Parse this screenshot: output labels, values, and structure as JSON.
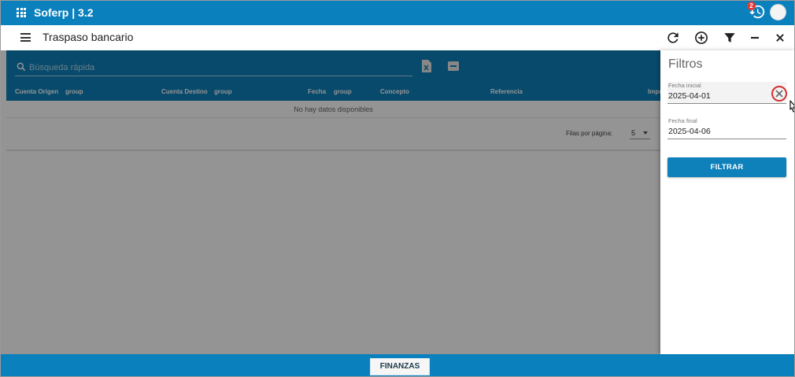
{
  "app": {
    "title": "Soferp | 3.2",
    "notification_count": "2"
  },
  "toolbar": {
    "title": "Traspaso bancario"
  },
  "table": {
    "search_placeholder": "Búsqueda rápida",
    "columns": [
      "Cuenta Origen",
      "group",
      "Cuenta Destino",
      "group",
      "Fecha",
      "group",
      "Concepto",
      "Referencia",
      "Impo"
    ],
    "empty_message": "No hay datos disponibles",
    "rows_per_page_label": "Filas por página:",
    "rows_per_page_value": "5"
  },
  "filters": {
    "title": "Filtros",
    "start_label": "Fecha inicial",
    "start_value": "2025-04-01",
    "end_label": "Fecha final",
    "end_value": "2025-04-06",
    "apply_label": "FILTRAR"
  },
  "footer": {
    "module_label": "FINANZAS"
  },
  "colors": {
    "primary": "#0a80bd",
    "accent_red": "#d32f2f",
    "badge": "#e53935"
  }
}
